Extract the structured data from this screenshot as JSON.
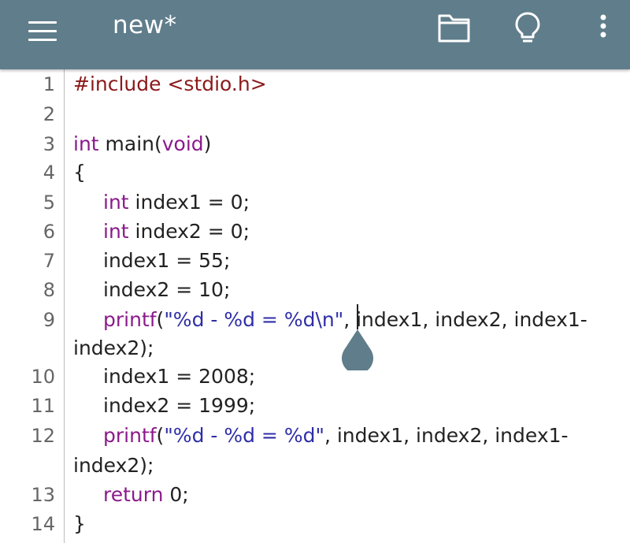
{
  "appbar": {
    "title": "new*",
    "background": "#607d8b",
    "icons": [
      "menu-icon",
      "folder-icon",
      "lightbulb-icon",
      "more-vert-icon"
    ]
  },
  "colors": {
    "preprocessor": "#8b1a1a",
    "keyword": "#8b1a8b",
    "string": "#2e2ea8",
    "text": "#222222"
  },
  "editor": {
    "line_numbers": [
      "1",
      "2",
      "3",
      "4",
      "5",
      "6",
      "7",
      "8",
      "9",
      "10",
      "11",
      "12",
      "13",
      "14"
    ],
    "lines": {
      "l1": {
        "pp": "#include <stdio.h>"
      },
      "l3": {
        "kw": "int",
        "txt": " main(",
        "kw2": "void",
        "txt2": ")"
      },
      "l4": {
        "txt": "{"
      },
      "l5": {
        "kw": "int",
        "txt": " index1 = 0;"
      },
      "l6": {
        "kw": "int",
        "txt": " index2 = 0;"
      },
      "l7": {
        "txt": "index1 = 55;"
      },
      "l8": {
        "txt": "index2 = 10;"
      },
      "l9": {
        "kw": "printf",
        "txt": "(",
        "str": "\"%d - %d = %d\\n\"",
        "txt2": ", index1, index2, index1-"
      },
      "l9b": {
        "txt": "index2);"
      },
      "l10": {
        "txt": "index1 = 2008;"
      },
      "l11": {
        "txt": "index2 = 1999;"
      },
      "l12": {
        "kw": "printf",
        "txt": "(",
        "str": "\"%d - %d = %d\"",
        "txt2": ", index1, index2, index1-"
      },
      "l12b": {
        "txt": "index2);"
      },
      "l13": {
        "kw": "return",
        "txt": " 0;"
      },
      "l14": {
        "txt": "}"
      }
    }
  }
}
